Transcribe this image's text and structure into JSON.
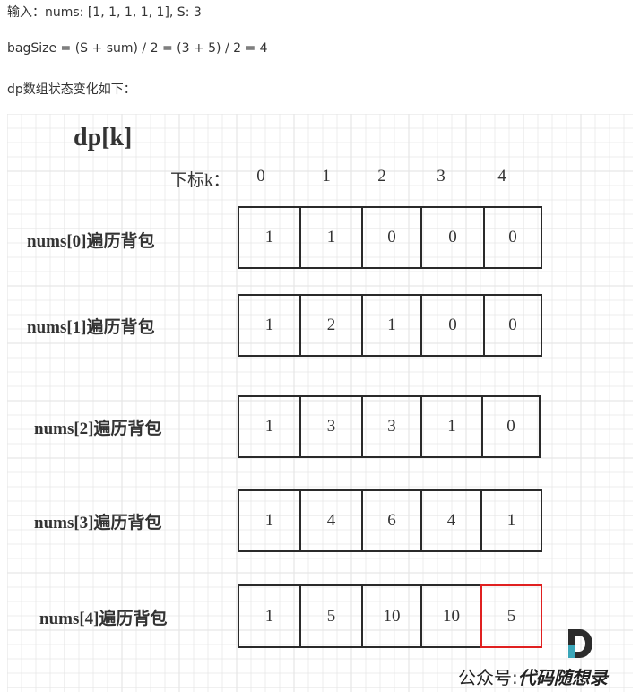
{
  "intro": {
    "line1": "输入：nums: [1, 1, 1, 1, 1], S: 3",
    "line2": "bagSize = (S + sum) / 2 = (3 + 5) / 2 = 4",
    "line3": "dp数组状态变化如下："
  },
  "figure": {
    "title": "dp[k]",
    "index_label": "下标k：",
    "indices": [
      "0",
      "1",
      "2",
      "3",
      "4"
    ],
    "rows": [
      {
        "label": "nums[0]遍历背包",
        "values": [
          "1",
          "1",
          "0",
          "0",
          "0"
        ]
      },
      {
        "label": "nums[1]遍历背包",
        "values": [
          "1",
          "2",
          "1",
          "0",
          "0"
        ]
      },
      {
        "label": "nums[2]遍历背包",
        "values": [
          "1",
          "3",
          "3",
          "1",
          "0"
        ]
      },
      {
        "label": "nums[3]遍历背包",
        "values": [
          "1",
          "4",
          "6",
          "4",
          "1"
        ]
      },
      {
        "label": "nums[4]遍历背包",
        "values": [
          "1",
          "5",
          "10",
          "10",
          "5"
        ]
      }
    ],
    "highlight": {
      "row": 4,
      "col": 4,
      "color": "#e02020"
    }
  },
  "watermark": {
    "prefix": "公众号:",
    "name": "代码随想录"
  },
  "colors": {
    "grid": "#e6e6e6",
    "cell_border": "#2a2a2a",
    "logo_dark": "#2b2b2b",
    "logo_accent": "#3aa6b9"
  }
}
